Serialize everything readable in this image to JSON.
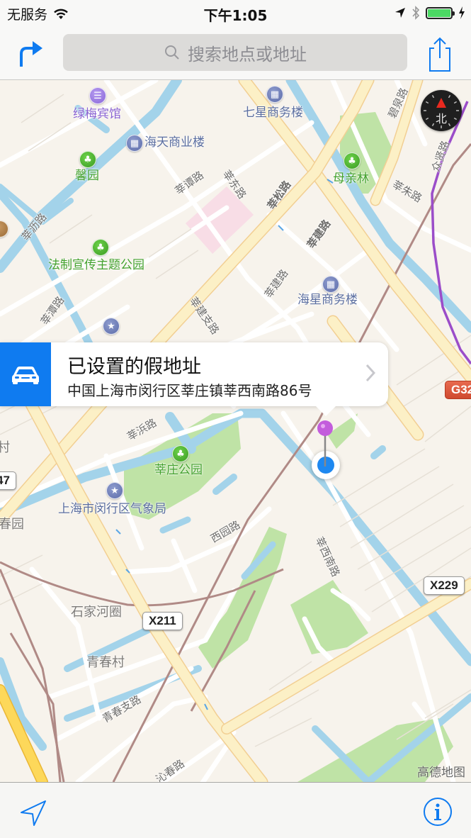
{
  "status_bar": {
    "carrier": "无服务",
    "time": "下午1:05",
    "battery_level": 1.0,
    "colors": {
      "battery": "#4cd964"
    }
  },
  "nav_bar": {
    "search_placeholder": "搜索地点或地址",
    "directions_icon": "turn-right-arrow-icon",
    "share_icon": "share-icon"
  },
  "map": {
    "compass_label": "北",
    "attribution": "高德地图",
    "poi": [
      {
        "name": "绿梅宾馆",
        "type": "hotel"
      },
      {
        "name": "七星商务楼",
        "type": "building"
      },
      {
        "name": "海天商业楼",
        "type": "building"
      },
      {
        "name": "馨园",
        "type": "park"
      },
      {
        "name": "母亲林",
        "type": "park"
      },
      {
        "name": "法制宣传主题公园",
        "type": "park"
      },
      {
        "name": "海星商务楼",
        "type": "building"
      },
      {
        "name": "莘庄公园",
        "type": "park"
      },
      {
        "name": "上海市闵行区气象局",
        "type": "government"
      }
    ],
    "roads": [
      "莘谭路",
      "莘东路",
      "莘松路",
      "碧泉路",
      "众贤路",
      "莘朱路",
      "莘沥路",
      "莘建路",
      "莘建路",
      "莘潭路",
      "莘建支路",
      "莘浜路",
      "西园路",
      "莘西南路",
      "青春支路",
      "沁春路"
    ],
    "places": [
      "石家河圈",
      "青春村",
      "春园",
      "村"
    ],
    "shields": [
      "X211",
      "X229",
      "47",
      "G32"
    ]
  },
  "callout": {
    "title": "已设置的假地址",
    "subtitle": "中国上海市闵行区莘庄镇莘西南路86号",
    "icon": "car-icon",
    "colors": {
      "accent": "#0f7bf0"
    }
  },
  "toolbar": {
    "locate_icon": "location-arrow-icon",
    "info_icon": "info-icon"
  }
}
